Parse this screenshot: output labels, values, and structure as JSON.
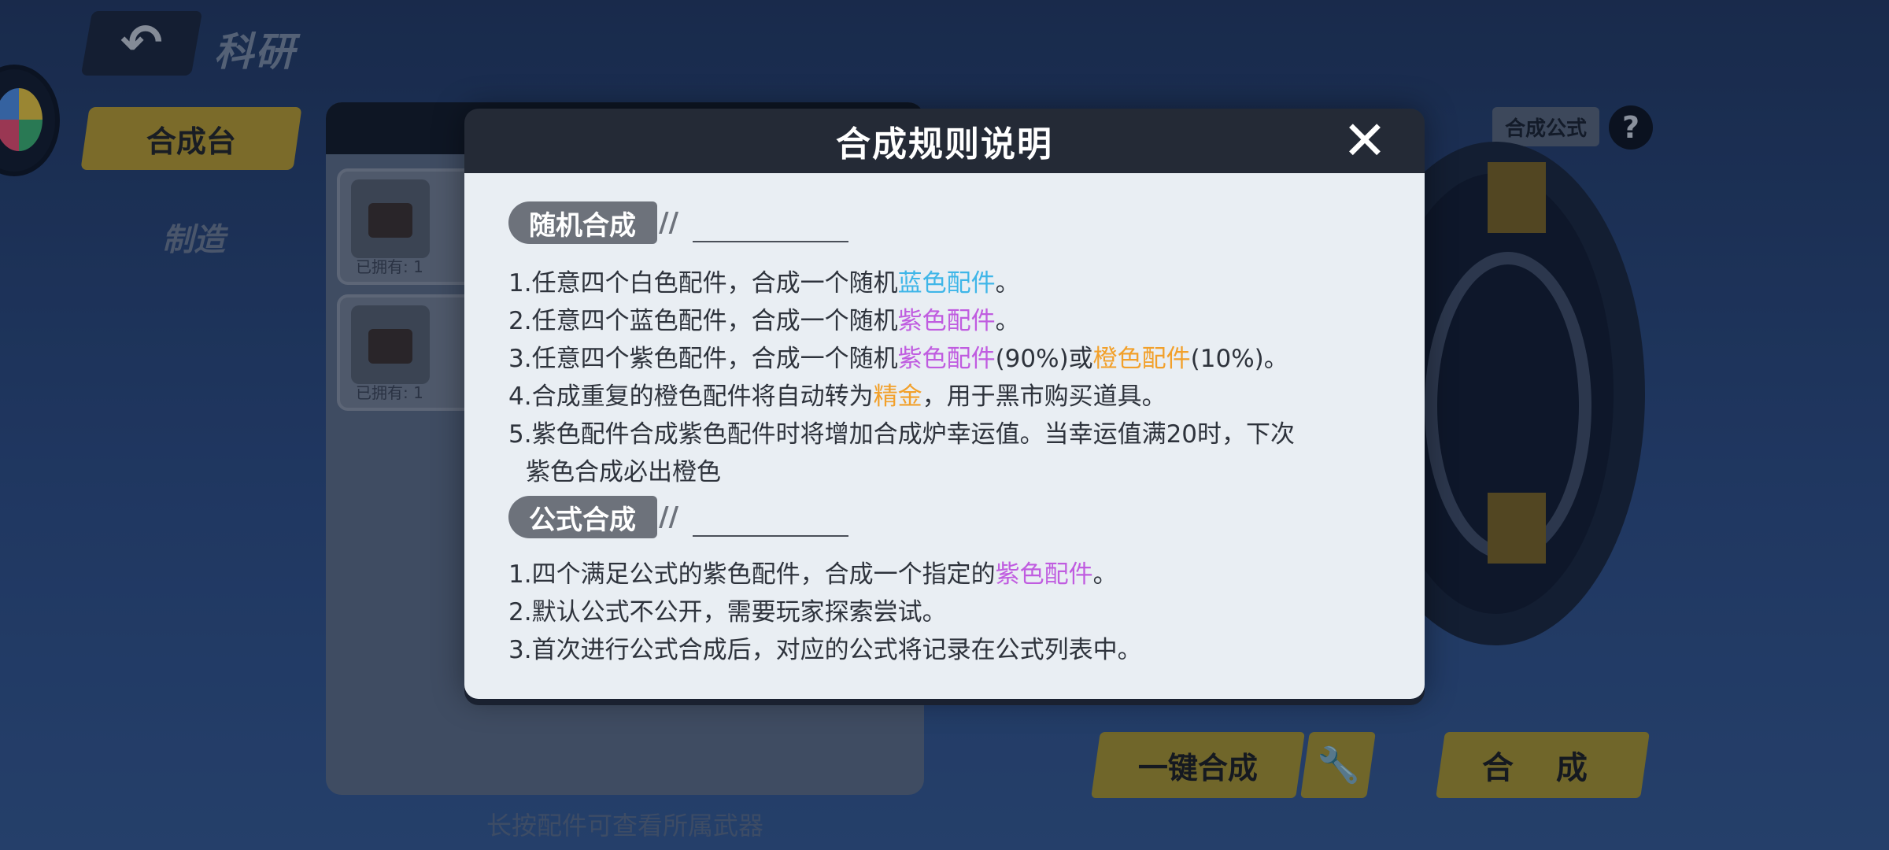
{
  "header": {
    "back_icon": "undo-arrow-icon",
    "title": "科研"
  },
  "left_tabs": [
    {
      "label": "合成台"
    },
    {
      "label": "制造"
    }
  ],
  "inventory": {
    "items": [
      {
        "icon": "engine-part-icon",
        "owned": "已拥有: 1"
      },
      {
        "icon": "battery-part-icon",
        "owned": "已拥有: 1"
      }
    ],
    "hint": "长按配件可查看所属武器"
  },
  "right_panel": {
    "formula_button": "合成公式",
    "help_button": "?",
    "onekey_button": "一键合成",
    "wrench_icon": "wrench-icon",
    "synth_button": "合 成"
  },
  "modal": {
    "title": "合成规则说明",
    "close_icon": "close-icon",
    "section1": {
      "label": "随机合成",
      "rules": [
        {
          "a": "1.任意四个白色配件，合成一个随机",
          "b": "蓝色配件",
          "c": "。"
        },
        {
          "a": "2.任意四个蓝色配件，合成一个随机",
          "b": "紫色配件",
          "c": "。"
        },
        {
          "a": "3.任意四个紫色配件，合成一个随机",
          "b": "紫色配件",
          "c": "(90%)或",
          "d": "橙色配件",
          "e": "(10%)。"
        },
        {
          "a": "4.合成重复的橙色配件将自动转为",
          "b": "精金",
          "c": "，用于黑市购买道具。"
        },
        {
          "a": "5.紫色配件合成紫色配件时将增加合成炉幸运值。当幸运值满20时，下次",
          "b": "紫色合成必出橙色"
        }
      ]
    },
    "section2": {
      "label": "公式合成",
      "rules": [
        {
          "a": "1.四个满足公式的紫色配件，合成一个指定的",
          "b": "紫色配件",
          "c": "。"
        },
        {
          "a": "2.默认公式不公开，需要玩家探索尝试。"
        },
        {
          "a": "3.首次进行公式合成后，对应的公式将记录在公式列表中。"
        }
      ]
    }
  },
  "colors": {
    "blue_part": "#3fb6e8",
    "purple_part": "#c05ce0",
    "orange_part": "#f2a02a"
  }
}
